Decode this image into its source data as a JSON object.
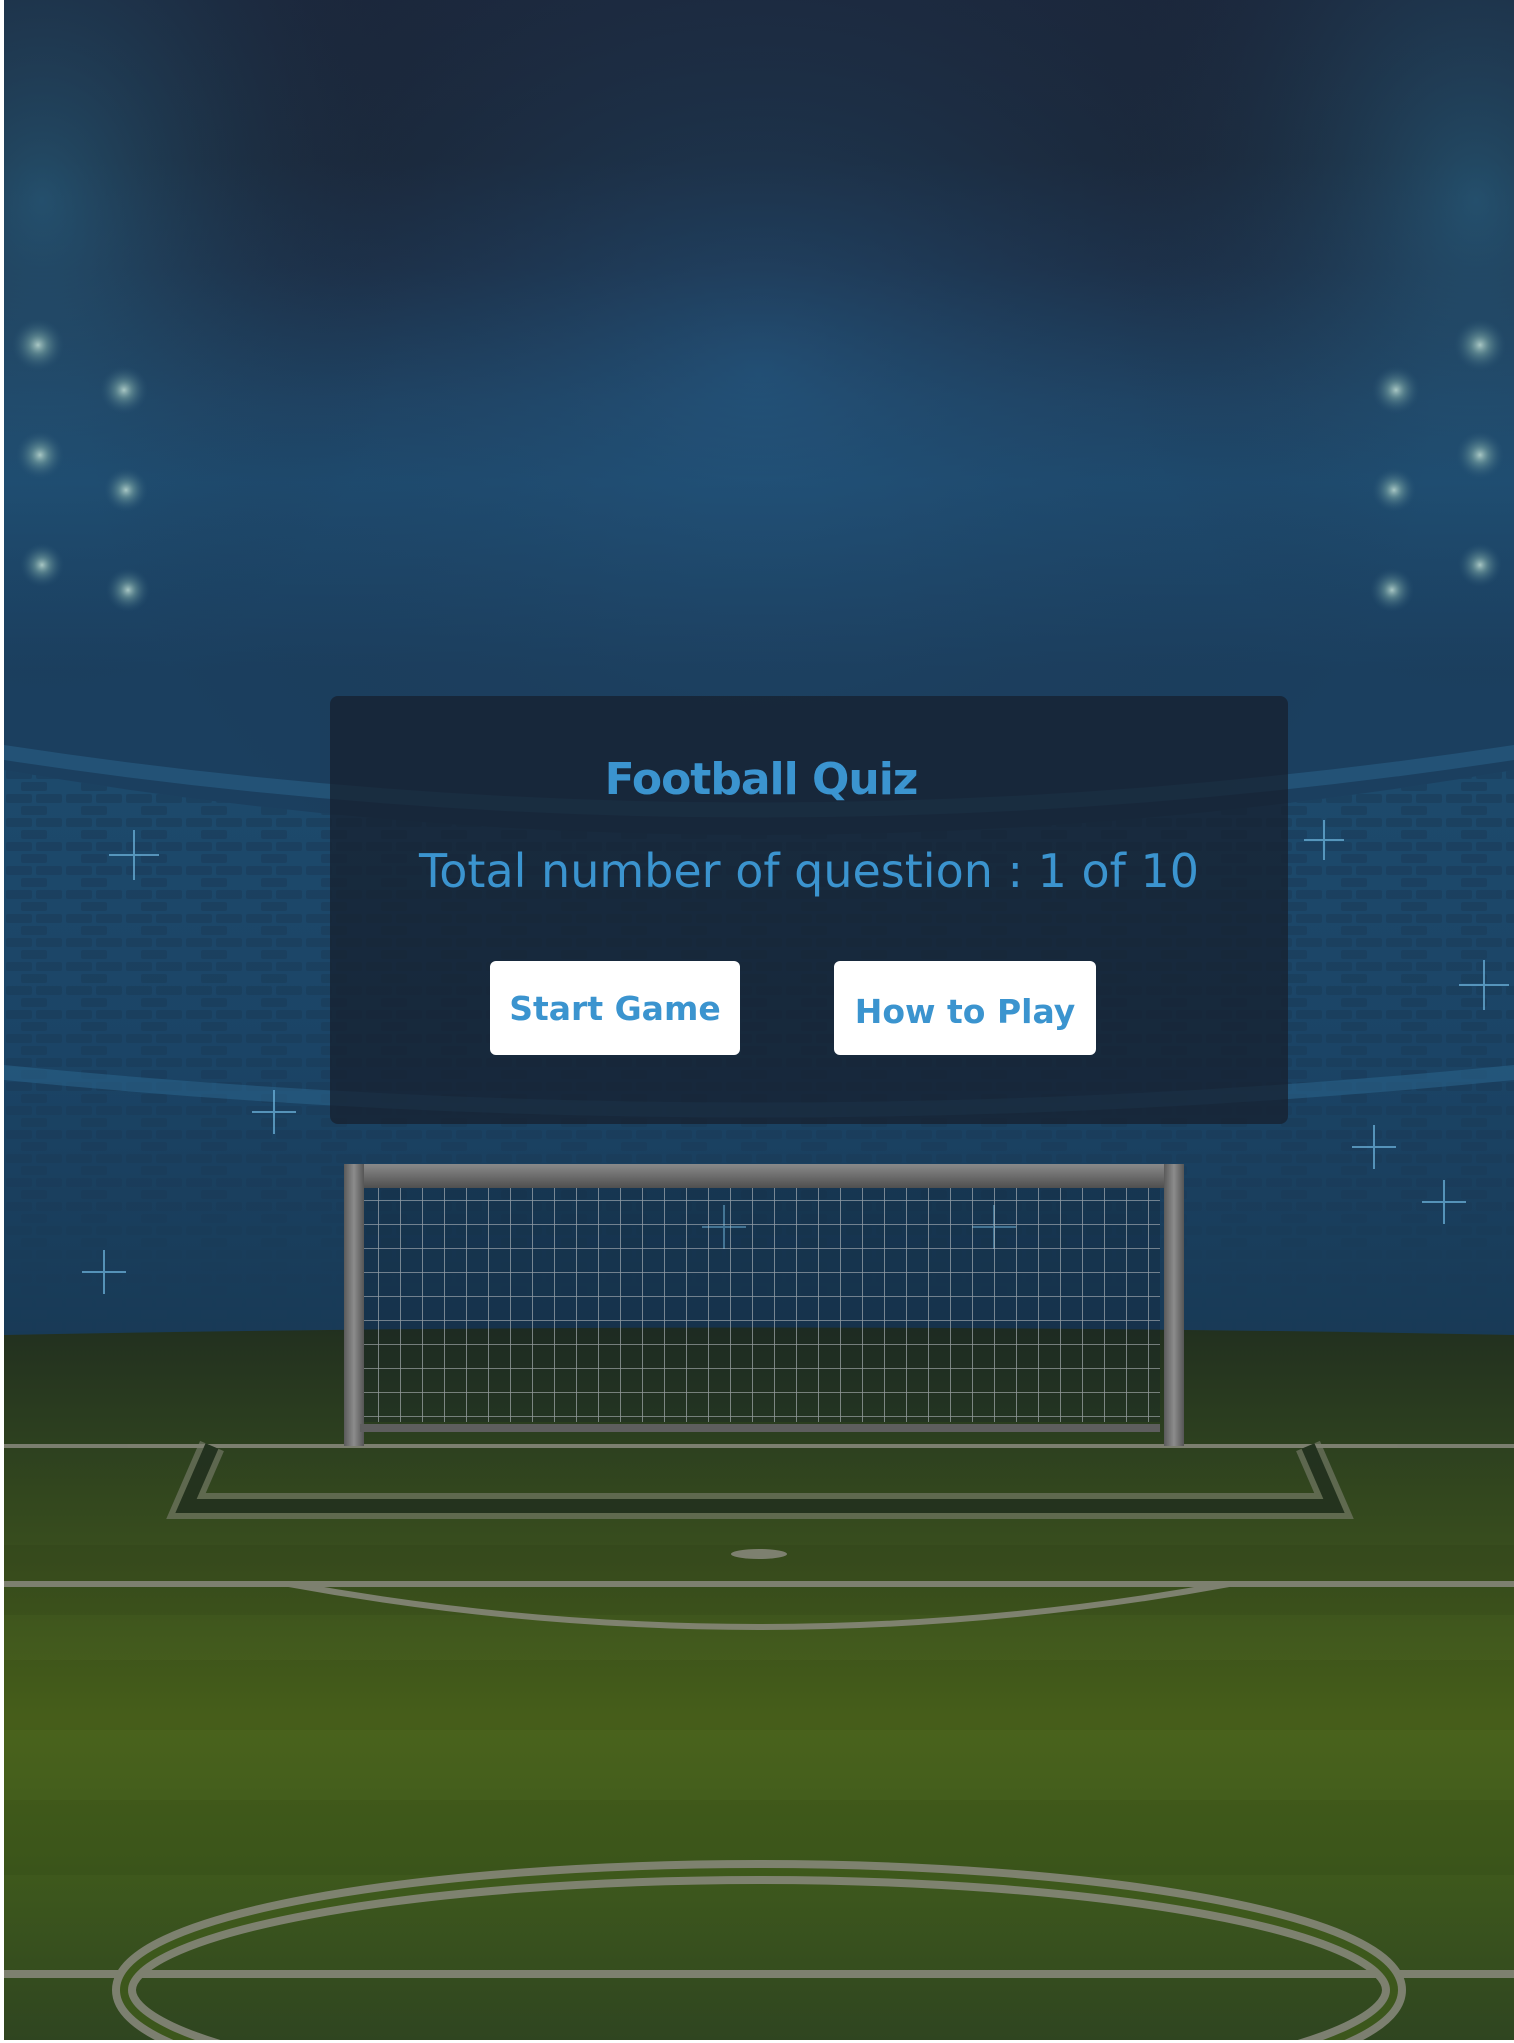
{
  "game": {
    "title": "Football Quiz",
    "question_counter": "Total number of question : 1 of 10",
    "current_question": 1,
    "total_questions": 10
  },
  "buttons": {
    "start": "Start Game",
    "how_to_play": "How to Play"
  },
  "colors": {
    "accent_text": "#3b94cf",
    "button_bg": "#ffffff",
    "sky_top": "#1a2538",
    "sky_glow": "#1e4f72",
    "pitch_light": "#4f6a1e",
    "pitch_dark": "#2e441e"
  }
}
